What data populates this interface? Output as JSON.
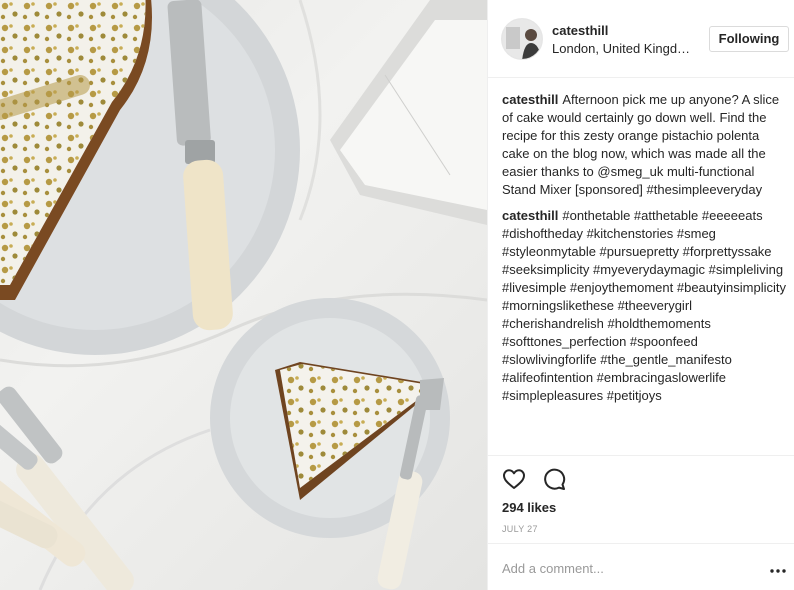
{
  "post": {
    "image_alt": "Slice of orange pistachio polenta cake on a plate"
  },
  "header": {
    "username": "catesthill",
    "location": "London, United Kingd…",
    "follow_label": "Following"
  },
  "caption": {
    "username": "catesthill",
    "text": "Afternoon pick me up anyone? A slice of cake would certainly go down well. Find the recipe for this zesty orange pistachio polenta cake on the blog now, which was made all the easier thanks to @smeg_uk multi-functional Stand Mixer [sponsored] #thesimpleeveryday"
  },
  "hashtags_comment": {
    "username": "catesthill",
    "text": "#onthetable #atthetable #eeeeeats #dishoftheday #kitchenstories #smeg #styleonmytable #pursuepretty #forprettyssake #seeksimplicity #myeverydaymagic #simpleliving #livesimple #enjoythemoment #beautyinsimplicity #morningslikethese #theeverygirl #cherishandrelish #holdthemoments #softtones_perfection #spoonfeed #slowlivingforlife #the_gentle_manifesto #alifeofintention #embracingaslowerlife #simplepleasures #petitjoys"
  },
  "actions": {
    "like_icon": "heart-icon",
    "comment_icon": "speech-bubble-icon",
    "likes": "294 likes",
    "date": "JULY 27"
  },
  "add_comment": {
    "placeholder": "Add a comment...",
    "more_icon": "more-options-icon"
  },
  "colors": {
    "text": "#262626",
    "muted": "#999999",
    "border": "#efefef"
  }
}
